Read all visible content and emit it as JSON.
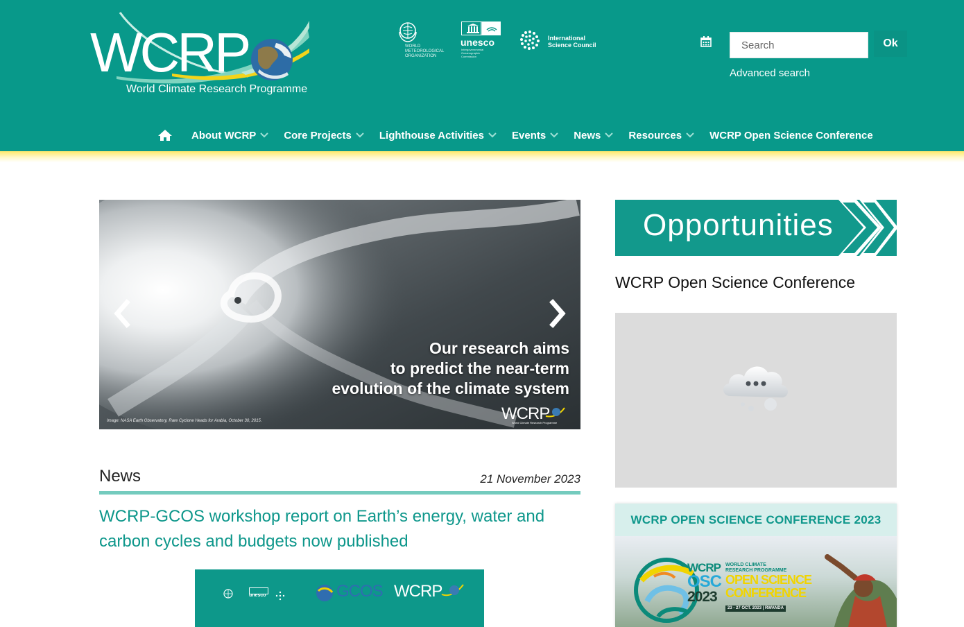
{
  "header": {
    "logo": {
      "word": "WCRP",
      "subtitle": "World Climate Research Programme"
    },
    "partners": {
      "wmo": [
        "WORLD",
        "METEOROLOGICAL",
        "ORGANIZATION"
      ],
      "unesco": {
        "word": "unesco",
        "sub": [
          "Intergovernmental",
          "Oceanographic",
          "Commission"
        ]
      },
      "isc": [
        "International",
        "Science Council"
      ]
    },
    "search": {
      "placeholder": "Search",
      "value": "",
      "ok_label": "Ok",
      "advanced_label": "Advanced search"
    }
  },
  "nav": {
    "items": [
      {
        "label": "About WCRP",
        "dropdown": true
      },
      {
        "label": "Core Projects",
        "dropdown": true
      },
      {
        "label": "Lighthouse Activities",
        "dropdown": true
      },
      {
        "label": "Events",
        "dropdown": true
      },
      {
        "label": "News",
        "dropdown": true
      },
      {
        "label": "Resources",
        "dropdown": true
      },
      {
        "label": "WCRP Open Science Conference",
        "dropdown": false
      }
    ]
  },
  "slider": {
    "caption": [
      "Our research aims",
      "to predict the near-term",
      "evolution of the climate system"
    ],
    "credit": "Image: NASA Earth Observatory, Rare Cyclone Heads for Arabia, October 30, 2015.",
    "logo_word": "WCRP",
    "logo_sub": "World Climate Research Programme"
  },
  "news": {
    "heading": "News",
    "date": "21 November 2023",
    "title": "WCRP-GCOS workshop report on Earth’s energy, water and carbon cycles and budgets now published",
    "image_logos": {
      "gcos": "GCOS",
      "wcrp": "WCRP",
      "unesco": "unesco"
    }
  },
  "sidebar": {
    "banner": "Opportunities",
    "title": "WCRP Open Science Conference",
    "card": {
      "heading": "WCRP OPEN SCIENCE CONFERENCE 2023",
      "image": {
        "lines": [
          "WCRP",
          "OSC",
          "2023"
        ],
        "right": [
          "WORLD CLIMATE",
          "RESEARCH PROGRAMME",
          "OPEN SCIENCE",
          "CONFERENCE",
          "23 - 27 OCT. 2023 | RWANDA"
        ]
      }
    }
  },
  "colors": {
    "brand": "#08998a",
    "accent": "#f1d400",
    "link": "#0e978b",
    "rule": "#74cbbe"
  },
  "icons": {
    "home": "home-icon",
    "calendar": "calendar-icon",
    "chevron": "chevron-down-icon",
    "prev": "chevron-left-icon",
    "next": "chevron-right-icon",
    "loading": "cloud-loading-icon"
  }
}
